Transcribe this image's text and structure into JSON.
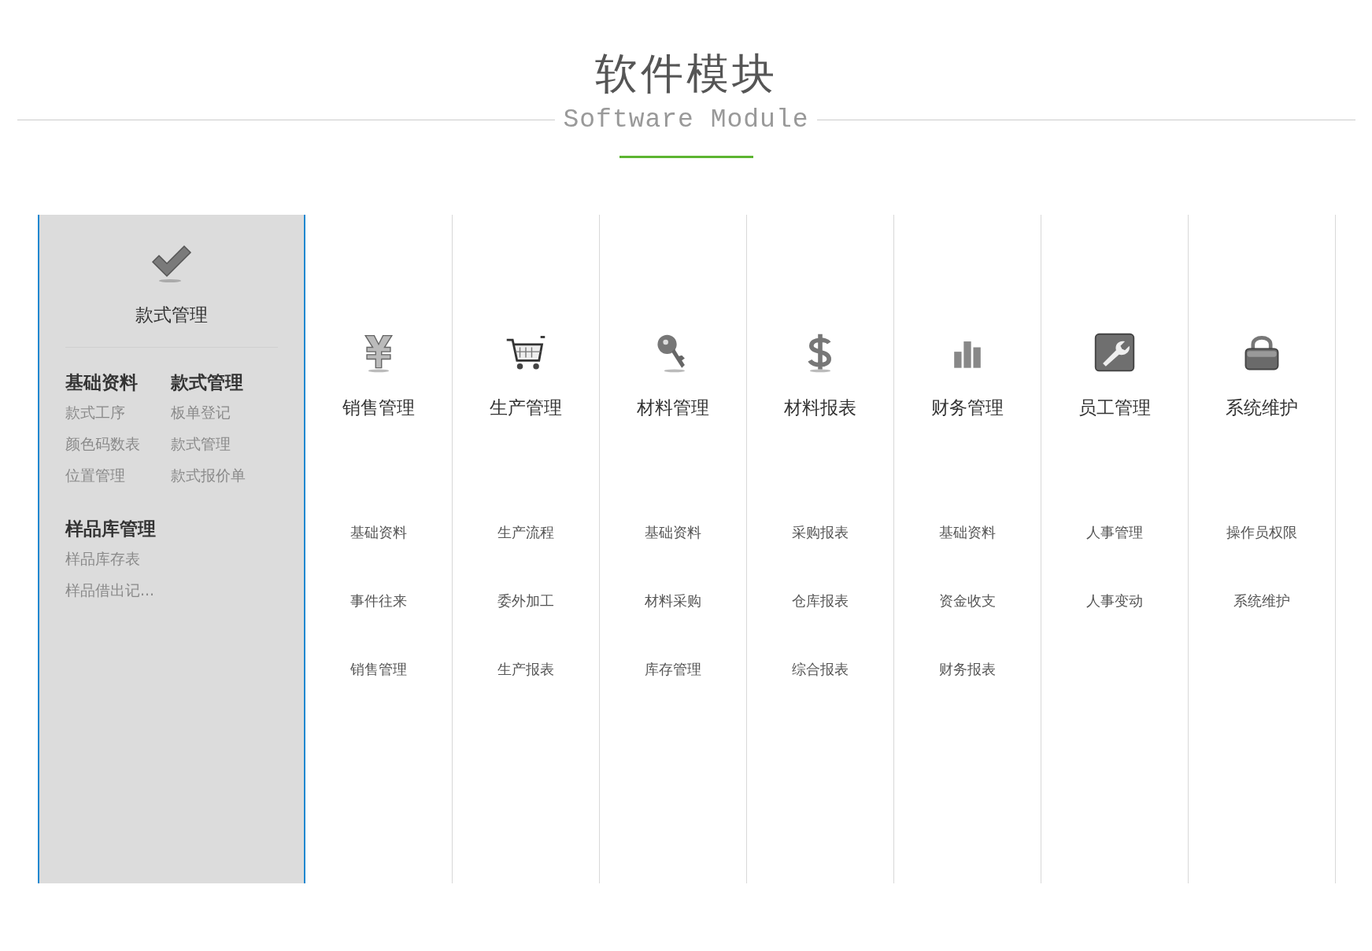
{
  "header": {
    "title": "软件模块",
    "subtitle": "Software Module"
  },
  "modules": [
    {
      "title": "款式管理",
      "expanded": true,
      "groups": [
        {
          "heading": "基础资料",
          "items": [
            "款式工序",
            "颜色码数表",
            "位置管理"
          ]
        },
        {
          "heading": "款式管理",
          "items": [
            "板单登记",
            "款式管理",
            "款式报价单"
          ]
        },
        {
          "heading": "样品库管理",
          "items": [
            "样品库存表",
            "样品借出记..."
          ]
        }
      ]
    },
    {
      "title": "销售管理",
      "expanded": false,
      "items": [
        "基础资料",
        "事件往来",
        "销售管理"
      ]
    },
    {
      "title": "生产管理",
      "expanded": false,
      "items": [
        "生产流程",
        "委外加工",
        "生产报表"
      ]
    },
    {
      "title": "材料管理",
      "expanded": false,
      "items": [
        "基础资料",
        "材料采购",
        "库存管理"
      ]
    },
    {
      "title": "材料报表",
      "expanded": false,
      "items": [
        "采购报表",
        "仓库报表",
        "综合报表"
      ]
    },
    {
      "title": "财务管理",
      "expanded": false,
      "items": [
        "基础资料",
        "资金收支",
        "财务报表"
      ]
    },
    {
      "title": "员工管理",
      "expanded": false,
      "items": [
        "人事管理",
        "人事变动"
      ]
    },
    {
      "title": "系统维护",
      "expanded": false,
      "items": [
        "操作员权限",
        "系统维护"
      ]
    }
  ]
}
